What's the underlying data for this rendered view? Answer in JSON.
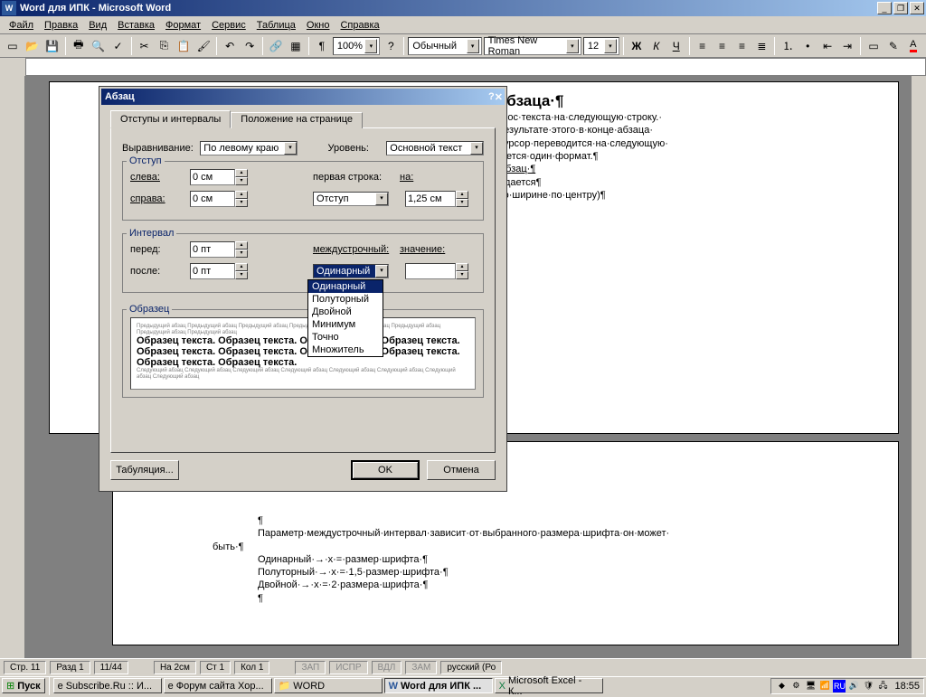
{
  "title": "Word для ИПК - Microsoft Word",
  "menu": [
    "Файл",
    "Правка",
    "Вид",
    "Вставка",
    "Формат",
    "Сервис",
    "Таблица",
    "Окно",
    "Справка"
  ],
  "toolbar2": {
    "zoom": "100%",
    "style": "Обычный",
    "font": "Times New Roman",
    "size": "12",
    "bold": "Ж",
    "italic": "К",
    "under": "Ч"
  },
  "dialog": {
    "title": "Абзац",
    "tab1": "Отступы и интервалы",
    "tab2": "Положение на странице",
    "alignment_label": "Выравнивание:",
    "alignment_value": "По левому краю",
    "level_label": "Уровень:",
    "level_value": "Основной текст",
    "indent_group": "Отступ",
    "left_label": "слева:",
    "left_value": "0 см",
    "right_label": "справа:",
    "right_value": "0 см",
    "firstline_label": "первая строка:",
    "firstline_value": "Отступ",
    "by_label": "на:",
    "by_value": "1,25 см",
    "spacing_group": "Интервал",
    "before_label": "перед:",
    "before_value": "0 пт",
    "after_label": "после:",
    "after_value": "0 пт",
    "linespacing_label": "междустрочный:",
    "linespacing_value": "Одинарный",
    "at_label": "значение:",
    "at_value": "",
    "options": [
      "Одинарный",
      "Полуторный",
      "Двойной",
      "Минимум",
      "Точно",
      "Множитель"
    ],
    "preview_label": "Образец",
    "tabs_btn": "Табуляция...",
    "ok_btn": "OK",
    "cancel_btn": "Отмена"
  },
  "doc": {
    "heading": "ние·абзаца·¶",
    "l1": "ий·перенос·текста·на·следующую·строку.·",
    "l2": "nter.·В·результате·этого·в·конце·абзаца·",
    "l3": "|….·,·а·курсор·переводится·на·следующую·",
    "l4": "·сохраняется·один·формат.¶",
    "l5": "мат·→·Абзац·¶",
    "l6": "а·ней·задается¶",
    "l7": "·краю,·по·ширине·по·центру)¶",
    "pm": "¶",
    "p2a": "¶",
    "p2b": "Параметр·междустрочный·интервал·зависит·от·выбранного·размера·шрифта·он·может·",
    "p2c": "быть·¶",
    "p2d": "Одинарный·→·x·=·размер·шрифта·¶",
    "p2e": "Полуторный·→·x·=·1,5·размер·шрифта·¶",
    "p2f": "Двойной·→·x·=·2·размера·шрифта·¶",
    "p2g": "¶"
  },
  "status": {
    "page": "Стр. 11",
    "section": "Разд 1",
    "pages": "11/44",
    "at": "На 2см",
    "line": "Ст 1",
    "col": "Кол 1",
    "rec": "ЗАП",
    "trk": "ИСПР",
    "ext": "ВДЛ",
    "ovr": "ЗАМ",
    "lang": "русский (Ро"
  },
  "taskbar": {
    "start": "Пуск",
    "t1": "Subscribe.Ru :: И...",
    "t2": "Форум сайта Хор...",
    "t3": "WORD",
    "t4": "Word для  ИПК ...",
    "t5": "Microsoft Excel - К...",
    "lang": "RU",
    "clock": "18:55"
  }
}
